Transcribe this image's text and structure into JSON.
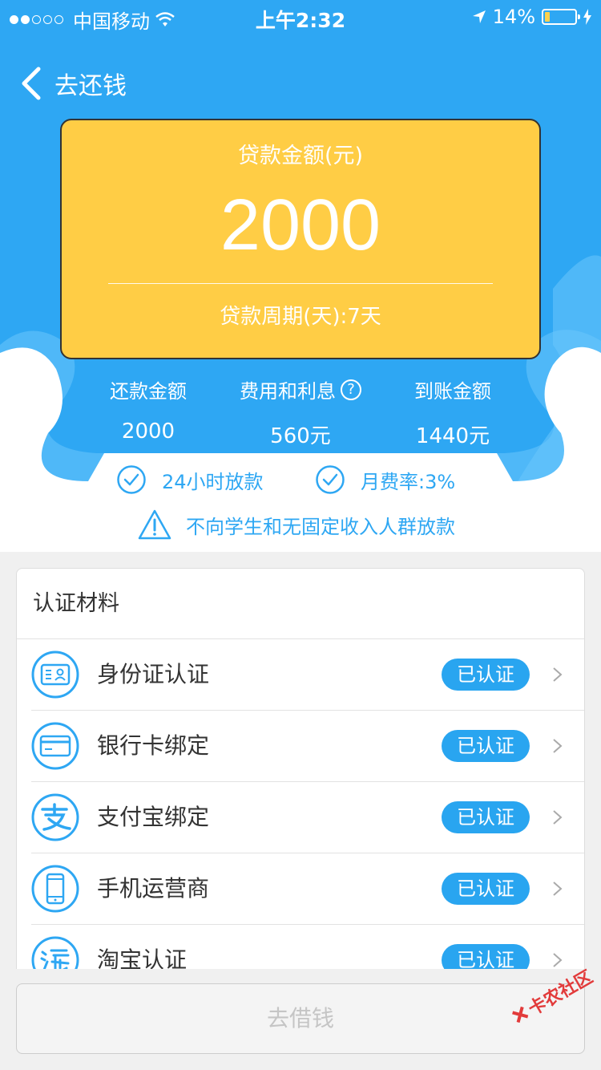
{
  "status_bar": {
    "carrier": "中国移动",
    "time": "上午2:32",
    "battery_percent": "14%"
  },
  "nav": {
    "back_label": "去还钱"
  },
  "loan_card": {
    "amount_label": "贷款金额(元)",
    "amount": "2000",
    "period": "贷款周期(天):7天"
  },
  "stats": {
    "repay_label": "还款金额",
    "repay_value": "2000",
    "fee_label": "费用和利息",
    "fee_value": "560元",
    "arrival_label": "到账金额",
    "arrival_value": "1440元"
  },
  "features": {
    "item1": "24小时放款",
    "item2": "月费率:3%",
    "notice": "不向学生和无固定收入人群放款"
  },
  "materials": {
    "title": "认证材料",
    "items": [
      {
        "label": "身份证认证",
        "status": "已认证",
        "icon": "id-card-icon"
      },
      {
        "label": "银行卡绑定",
        "status": "已认证",
        "icon": "bank-card-icon"
      },
      {
        "label": "支付宝绑定",
        "status": "已认证",
        "icon": "alipay-icon"
      },
      {
        "label": "手机运营商",
        "status": "已认证",
        "icon": "phone-icon"
      },
      {
        "label": "淘宝认证",
        "status": "已认证",
        "icon": "taobao-icon"
      }
    ]
  },
  "borrow_button": "去借钱",
  "watermark": "卡农社区",
  "colors": {
    "primary": "#2ea7f3",
    "card": "#ffcd45",
    "badge": "#29a5f0"
  }
}
